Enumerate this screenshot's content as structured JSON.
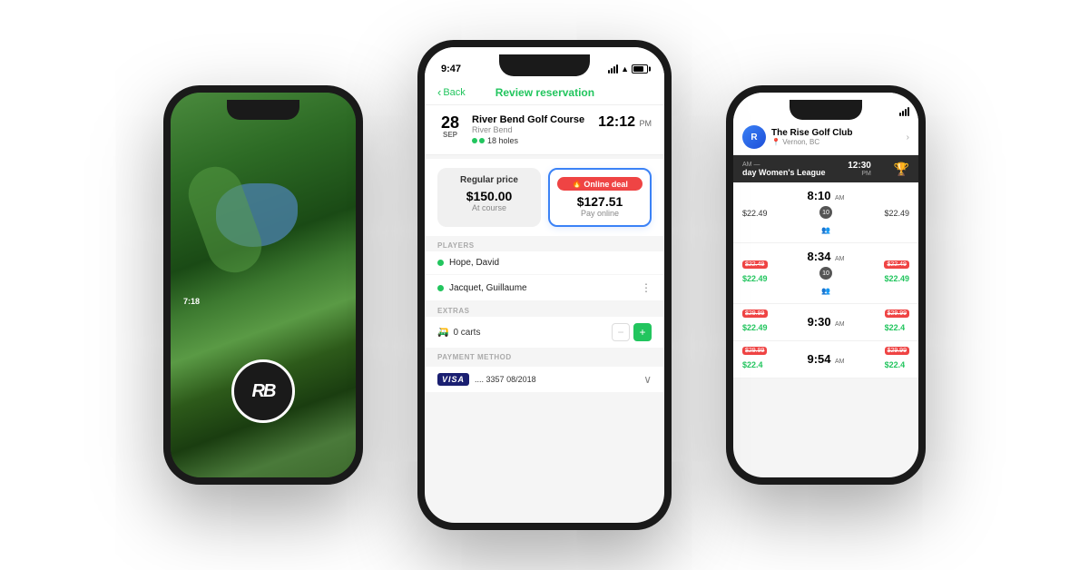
{
  "left_phone": {
    "status_time": "7:18",
    "logo_text": "RB"
  },
  "center_phone": {
    "status_time": "9:47",
    "nav": {
      "back_label": "Back",
      "title": "Review reservation"
    },
    "reservation": {
      "date_day": "28",
      "date_month": "SEP",
      "course_name": "River Bend Golf Course",
      "course_location": "River Bend",
      "holes": "18 holes",
      "tee_time": "12:12",
      "tee_time_period": "PM"
    },
    "pricing": {
      "regular_label": "Regular price",
      "regular_amount": "$150.00",
      "regular_sub": "At course",
      "online_label": "Online deal",
      "online_amount": "$127.51",
      "online_sub": "Pay online"
    },
    "players": {
      "section_label": "PLAYERS",
      "items": [
        {
          "name": "Hope, David"
        },
        {
          "name": "Jacquet, Guillaume"
        }
      ]
    },
    "extras": {
      "section_label": "EXTRAS",
      "carts_label": "0 carts"
    },
    "payment": {
      "section_label": "PAYMENT METHOD",
      "card_brand": "VISA",
      "card_last4": ".... 3357",
      "card_expiry": "08/2018"
    }
  },
  "right_phone": {
    "club_name": "The Rise Golf Club",
    "club_location": "Vernon, BC",
    "league": {
      "name": "day Women's League",
      "time": "12:30",
      "time_period": "PM"
    },
    "tee_slots": [
      {
        "time": "8:10",
        "time_period": "AM",
        "count": "10",
        "price_left": "$22.49",
        "price_right": "$22.49"
      },
      {
        "time": "8:34",
        "time_period": "AM",
        "count": "10",
        "price_left": "$22.49",
        "original_price": "$29.99",
        "deal_price": "$22.49"
      },
      {
        "time": "9:30",
        "time_period": "AM",
        "price_left": "$29.99",
        "deal_price": "$22.49",
        "price_right": "$29.99",
        "deal_price_right": "$22.4"
      },
      {
        "time": "9:54",
        "time_period": "AM",
        "price_left": "$29.99",
        "deal_price": "$22.4"
      }
    ]
  }
}
